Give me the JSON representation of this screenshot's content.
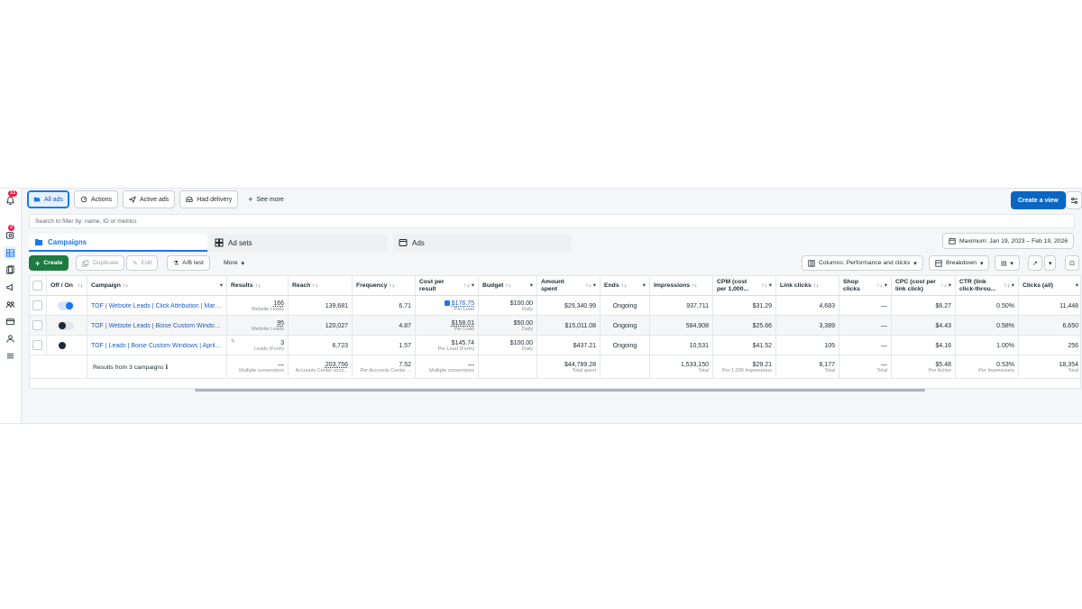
{
  "rail": {
    "items": [
      {
        "name": "notifications-icon",
        "badge": "11"
      },
      {
        "name": "account-alerts-icon",
        "badge": "2"
      },
      {
        "name": "table-icon",
        "badge": ""
      },
      {
        "name": "pages-icon",
        "badge": ""
      },
      {
        "name": "campaign-megaphone-icon",
        "badge": ""
      },
      {
        "name": "audiences-icon",
        "badge": ""
      },
      {
        "name": "billing-card-icon",
        "badge": ""
      },
      {
        "name": "settings-people-icon",
        "badge": ""
      },
      {
        "name": "menu-icon",
        "badge": ""
      }
    ]
  },
  "filters": {
    "all_ads": "All ads",
    "actions": "Actions",
    "active_ads": "Active ads",
    "had_delivery": "Had delivery",
    "see_more": "See more",
    "create_view": "Create a view"
  },
  "search": {
    "placeholder": "Search to filter by: name, ID or metrics"
  },
  "tabs": {
    "campaigns": "Campaigns",
    "ad_sets": "Ad sets",
    "ads": "Ads"
  },
  "date_range": "Maximum: Jan 19, 2023 – Feb 19, 2026",
  "toolbar": {
    "create": "Create",
    "duplicate": "Duplicate",
    "edit": "Edit",
    "ab_test": "A/B test",
    "more": "More",
    "columns": "Columns: Performance and clicks",
    "breakdown": "Breakdown"
  },
  "table": {
    "headers": {
      "offon": "Off / On",
      "campaign": "Campaign",
      "results": "Results",
      "reach": "Reach",
      "frequency": "Frequency",
      "cpr": "Cost per result",
      "budget": "Budget",
      "spent": "Amount spent",
      "ends": "Ends",
      "impressions": "Impressions",
      "cpm": "CPM (cost per 1,000...",
      "linkclicks": "Link clicks",
      "shopclicks": "Shop clicks",
      "cpc": "CPC (cost per link click)",
      "ctr": "CTR (link click-throu...",
      "clicksall": "Clicks (all)"
    },
    "rows": [
      {
        "status": "on",
        "campaign": "TOF | Website Leads | Click Attribution | Marc...",
        "results": "166",
        "results_sub": "Website Leads",
        "reach": "139,681",
        "frequency": "6.71",
        "cpr": "$176.75",
        "cpr_sub": "Per Lead",
        "budget": "$100.00",
        "budget_sub": "Daily",
        "spent": "$29,340.99",
        "ends": "Ongoing",
        "impressions": "937,711",
        "cpm": "$31.29",
        "linkclicks": "4,683",
        "shopclicks": "—",
        "cpc": "$6.27",
        "ctr": "0.50%",
        "clicksall": "11,448"
      },
      {
        "status": "off",
        "campaign": "TOF | Website Leads | Boise Custom Window...",
        "results": "95",
        "results_sub": "Website Leads",
        "reach": "120,027",
        "frequency": "4.87",
        "cpr": "$158.01",
        "cpr_sub": "Per Lead",
        "budget": "$50.00",
        "budget_sub": "Daily",
        "spent": "$15,011.08",
        "ends": "Ongoing",
        "impressions": "584,908",
        "cpm": "$25.66",
        "linkclicks": "3,389",
        "shopclicks": "—",
        "cpc": "$4.43",
        "ctr": "0.58%",
        "clicksall": "6,650"
      },
      {
        "status": "off",
        "campaign": "TOF | Leads | Boise Custom Windows | April 2...",
        "results": "3",
        "results_sub": "Leads (Form)",
        "reach": "6,723",
        "frequency": "1.57",
        "cpr": "$145.74",
        "cpr_sub": "Per Lead (Form)",
        "budget": "$100.00",
        "budget_sub": "Daily",
        "spent": "$437.21",
        "ends": "Ongoing",
        "impressions": "10,531",
        "cpm": "$41.52",
        "linkclicks": "105",
        "shopclicks": "—",
        "cpc": "$4.16",
        "ctr": "1.00%",
        "clicksall": "256"
      }
    ],
    "totals": {
      "label": "Results from 3 campaigns",
      "results": "—",
      "results_sub": "Multiple conversions",
      "reach": "203,756",
      "reach_sub": "Accounts Center acco...",
      "frequency": "7.52",
      "frequency_sub": "Per Accounts Center ...",
      "cpr": "—",
      "cpr_sub": "Multiple conversions",
      "spent": "$44,789.28",
      "spent_sub": "Total spent",
      "impressions": "1,533,150",
      "impressions_sub": "Total",
      "cpm": "$29.21",
      "cpm_sub": "Per 1,000 Impressions",
      "linkclicks": "8,177",
      "linkclicks_sub": "Total",
      "shopclicks": "—",
      "shopclicks_sub": "Total",
      "cpc": "$5.48",
      "cpc_sub": "Per Action",
      "ctr": "0.53%",
      "ctr_sub": "Per Impressions",
      "clicksall": "18,354",
      "clicksall_sub": "Total"
    }
  },
  "colors": {
    "accent": "#1877f2",
    "create_green": "#1e7a3f",
    "create_view_blue": "#0a66c2",
    "badge_red": "#e41e3f"
  }
}
